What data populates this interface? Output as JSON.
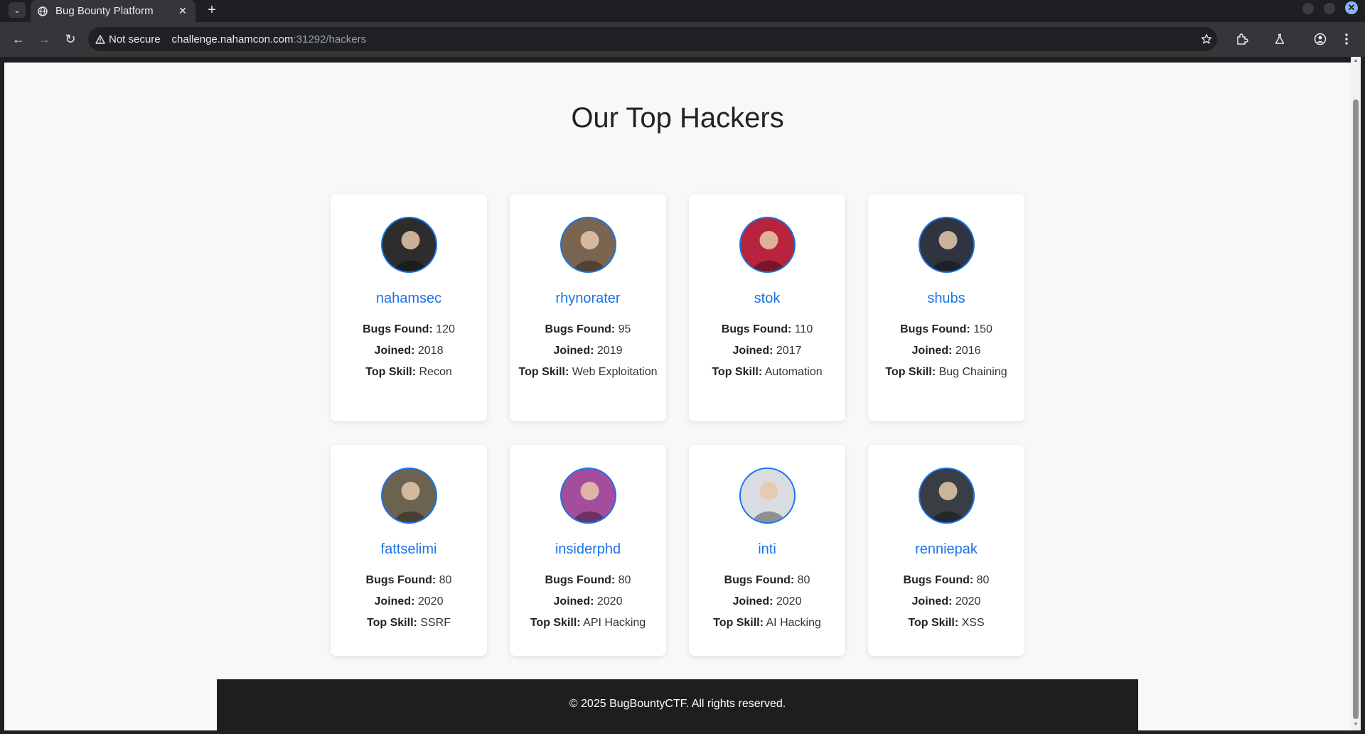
{
  "browser": {
    "tab_title": "Bug Bounty Platform",
    "security_label": "Not secure",
    "url_host": "challenge.nahamcon.com",
    "url_rest": ":31292/hackers"
  },
  "page": {
    "heading": "Our Top Hackers",
    "labels": {
      "bugs": "Bugs Found:",
      "joined": "Joined:",
      "skill": "Top Skill:"
    },
    "hackers": [
      {
        "name": "nahamsec",
        "bugs": " 120",
        "joined": " 2018",
        "skill": " Recon",
        "avatar_color": "#2d2d2d"
      },
      {
        "name": "rhynorater",
        "bugs": " 95",
        "joined": " 2019",
        "skill": " Web Exploitation",
        "avatar_color": "#7a6550"
      },
      {
        "name": "stok",
        "bugs": " 110",
        "joined": " 2017",
        "skill": " Automation",
        "avatar_color": "#b8233d"
      },
      {
        "name": "shubs",
        "bugs": " 150",
        "joined": " 2016",
        "skill": " Bug Chaining",
        "avatar_color": "#2f3440"
      },
      {
        "name": "fattselimi",
        "bugs": " 80",
        "joined": " 2020",
        "skill": " SSRF",
        "avatar_color": "#6c6250"
      },
      {
        "name": "insiderphd",
        "bugs": " 80",
        "joined": " 2020",
        "skill": " API Hacking",
        "avatar_color": "#a34d9c"
      },
      {
        "name": "inti",
        "bugs": " 80",
        "joined": " 2020",
        "skill": " AI Hacking",
        "avatar_color": "#d9dde2"
      },
      {
        "name": "renniepak",
        "bugs": " 80",
        "joined": " 2020",
        "skill": " XSS",
        "avatar_color": "#3a3d44"
      }
    ],
    "footer": "© 2025 BugBountyCTF. All rights reserved."
  }
}
